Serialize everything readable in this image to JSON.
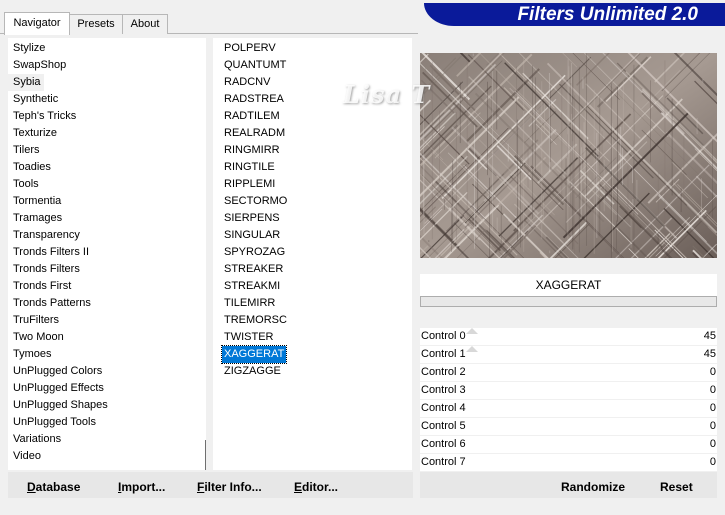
{
  "tabs": [
    {
      "label": "Navigator"
    },
    {
      "label": "Presets"
    },
    {
      "label": "About"
    }
  ],
  "banner": {
    "title": "Filters Unlimited 2.0"
  },
  "watermark": "Lisa T",
  "categories": [
    "Stylize",
    "SwapShop",
    "Sybia",
    "Synthetic",
    "Teph's Tricks",
    "Texturize",
    "Tilers",
    "Toadies",
    "Tools",
    "Tormentia",
    "Tramages",
    "Transparency",
    "Tronds Filters II",
    "Tronds Filters",
    "Tronds First",
    "Tronds Patterns",
    "TruFilters",
    "Two Moon",
    "Tymoes",
    "UnPlugged Colors",
    "UnPlugged Effects",
    "UnPlugged Shapes",
    "UnPlugged Tools",
    "Variations",
    "Video"
  ],
  "current_category": "Sybia",
  "filters": [
    "POLPERV",
    "QUANTUMT",
    "RADCNV",
    "RADSTREA",
    "RADTILEM",
    "REALRADM",
    "RINGMIRR",
    "RINGTILE",
    "RIPPLEMI",
    "SECTORMO",
    "SIERPENS",
    "SINGULAR",
    "SPYROZAG",
    "STREAKER",
    "STREAKMI",
    "TILEMIRR",
    "TREMORSC",
    "TWISTER",
    "XAGGERAT",
    "ZIGZAGGE"
  ],
  "selected_filter": "XAGGERAT",
  "filter_name": "XAGGERAT",
  "controls": [
    {
      "label": "Control 0",
      "value": "45"
    },
    {
      "label": "Control 1",
      "value": "45"
    },
    {
      "label": "Control 2",
      "value": "0"
    },
    {
      "label": "Control 3",
      "value": "0"
    },
    {
      "label": "Control 4",
      "value": "0"
    },
    {
      "label": "Control 5",
      "value": "0"
    },
    {
      "label": "Control 6",
      "value": "0"
    },
    {
      "label": "Control 7",
      "value": "0"
    }
  ],
  "buttons": {
    "database": {
      "u": "D",
      "rest": "atabase"
    },
    "import": {
      "u": "I",
      "rest": "mport..."
    },
    "filter_info": {
      "u": "F",
      "rest": "ilter Info..."
    },
    "editor": {
      "u": "E",
      "rest": "ditor..."
    },
    "randomize": "Randomize",
    "reset": "Reset"
  }
}
